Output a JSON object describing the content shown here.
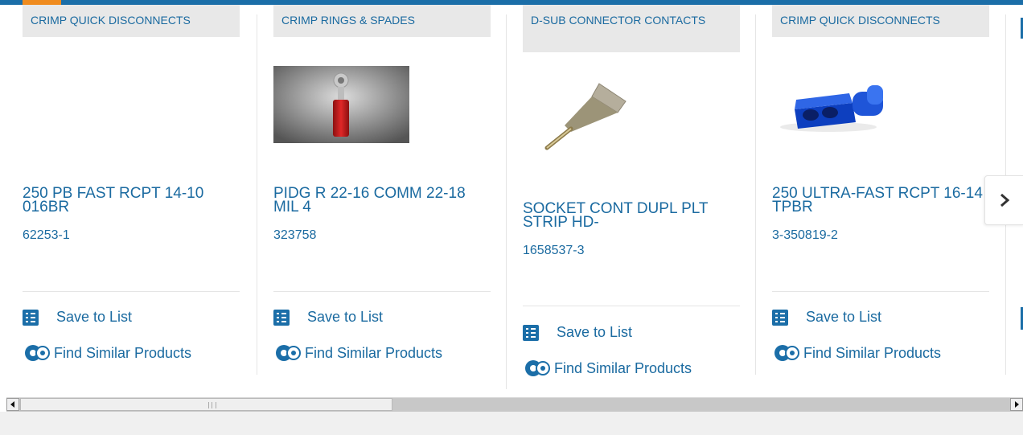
{
  "colors": {
    "accent": "#1b6ea8",
    "highlight": "#ef8b1e",
    "link": "#1a6aa0",
    "category_bg": "#e8e8e8"
  },
  "products": [
    {
      "category": "CRIMP QUICK DISCONNECTS",
      "title": "250 PB FAST RCPT 14-10 016BR",
      "part_number": "62253-1",
      "save_label": "Save to List",
      "similar_label": "Find Similar Products"
    },
    {
      "category": "CRIMP RINGS & SPADES",
      "title": "PIDG R 22-16 COMM 22-18 MIL 4",
      "part_number": "323758",
      "save_label": "Save to List",
      "similar_label": "Find Similar Products"
    },
    {
      "category": "D-SUB CONNECTOR CONTACTS",
      "title": "SOCKET CONT DUPL PLT STRIP HD-",
      "part_number": "1658537-3",
      "save_label": "Save to List",
      "similar_label": "Find Similar Products"
    },
    {
      "category": "CRIMP QUICK DISCONNECTS",
      "title": "250 ULTRA-FAST RCPT 16-14 TPBR",
      "part_number": "3-350819-2",
      "save_label": "Save to List",
      "similar_label": "Find Similar Products"
    }
  ],
  "icons": {
    "save": "checklist-icon",
    "similar": "gears-icon",
    "next": "chevron-right-icon"
  }
}
